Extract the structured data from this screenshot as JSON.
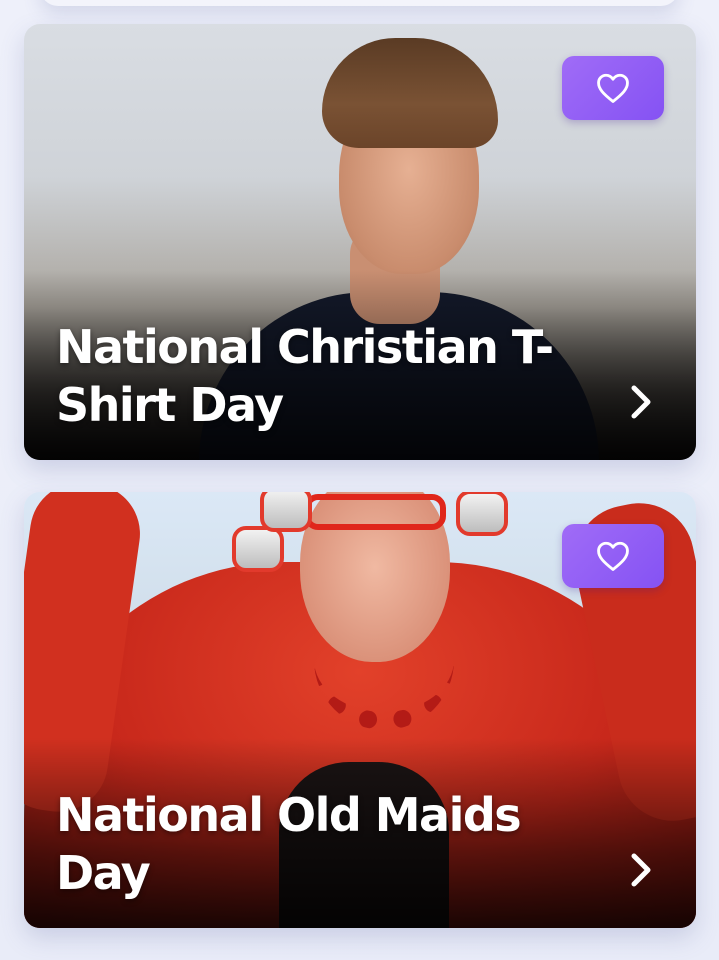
{
  "cards": [
    {
      "title": "National Christian T-Shirt Day",
      "favorite_icon": "heart-outline-icon",
      "arrow_icon": "chevron-right-icon"
    },
    {
      "title": "National Old Maids Day",
      "favorite_icon": "heart-outline-icon",
      "arrow_icon": "chevron-right-icon"
    }
  ],
  "colors": {
    "accent": "#9461f5",
    "background": "#eceff9",
    "title_text": "#ffffff"
  }
}
